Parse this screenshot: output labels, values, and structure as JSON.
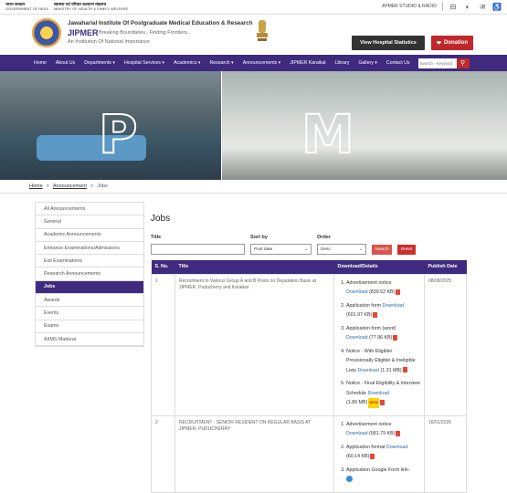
{
  "topbar": {
    "gov_india_line1": "भारत सरकार",
    "gov_india_line2": "GOVERNMENT OF INDIA",
    "ministry_line1": "स्वास्थ्य एवं परिवार कल्याण मंत्रालय",
    "ministry_line2": "MINISTRY OF HEALTH & FAMILY WELFARE",
    "studio": "JIPMER STUDIO & RADIO",
    "icons": [
      "screen-reader-icon",
      "contrast-icon",
      "hindi-language-icon",
      "accessibility-icon"
    ],
    "lang_glyph": "अ",
    "access_glyph": "♿"
  },
  "header": {
    "institute": "Jawaharlal Institute Of Postgraduate Medical Education & Research",
    "short_name": "JIPMER",
    "tagline": "Breaking Boundaries.. Finding Frontiers..",
    "subtitle": "An Institution Of National Importance",
    "stats_button": "View Hospital Statistics",
    "donate_button": "Donation"
  },
  "nav": {
    "items": [
      "Home",
      "About Us",
      "Departments ▾",
      "Hospital Services ▾",
      "Academics ▾",
      "Research ▾",
      "Announcements ▾",
      "JIPMER Karaikal",
      "Library",
      "Gallery ▾",
      "Contact Us"
    ],
    "search_placeholder": "Search - Keyword"
  },
  "banner": {
    "letter1": "P",
    "letter2": "M"
  },
  "breadcrumb": {
    "home": "Home",
    "sep": ">",
    "announcement": "Announcement",
    "current": "Jobs"
  },
  "sidebar": {
    "items": [
      "All Announcements",
      "General",
      "Academic Announcements",
      "Entrance Examinations/Admissions",
      "Exit Examinations",
      "Research Announcements",
      "Jobs",
      "Awards",
      "Events",
      "Exams",
      "AIIMS Madurai"
    ],
    "active_index": 6
  },
  "main": {
    "title": "Jobs",
    "filters": {
      "title_label": "Title",
      "title_value": "",
      "sort_label": "Sort by",
      "sort_value": "Post date",
      "order_label": "Order",
      "order_value": "Desc",
      "search_button": "Search",
      "reset_button": "Reset"
    },
    "table": {
      "headers": [
        "S. No.",
        "Title",
        "Download/Details",
        "Publish Date"
      ],
      "rows": [
        {
          "sno": "1",
          "title": "Recruitment to Various Group A and B Posts on Deputation Basis at JIPMER, Puducherry and Karaikal",
          "date": "08/08/2025",
          "downloads": [
            {
              "label": "Advertisement notice",
              "link": "Download",
              "size": "(839.52 KB)"
            },
            {
              "label": "Application form",
              "link": "Download",
              "size": "(601.97 KB)"
            },
            {
              "label": "Application form (word)",
              "link": "Download",
              "size": "(77.96 KB)"
            },
            {
              "label": "Notice - With Eligible/ Provisionally Eligible & Ineligible Lists",
              "link": "Download",
              "size": "(1.31 MB)"
            },
            {
              "label": "Notice - Final Eligibility & Interview Schedule",
              "link": "Download",
              "size": "(1.89 MB)"
            }
          ]
        },
        {
          "sno": "2",
          "title": "RECRUITMENT - SENIOR RESIDENT ON REGULAR BASIS AT JIPMER, PUDUCHERRY",
          "date": "16/01/2026",
          "downloads": [
            {
              "label": "Advertisement notice",
              "link": "Download",
              "size": "(581.79 KB)"
            },
            {
              "label": "Application format",
              "link": "Download",
              "size": "(60.14 KB)"
            },
            {
              "label": "Application Google Form link-",
              "link": "",
              "size": ""
            }
          ]
        }
      ]
    },
    "new_badge": "NEW"
  }
}
